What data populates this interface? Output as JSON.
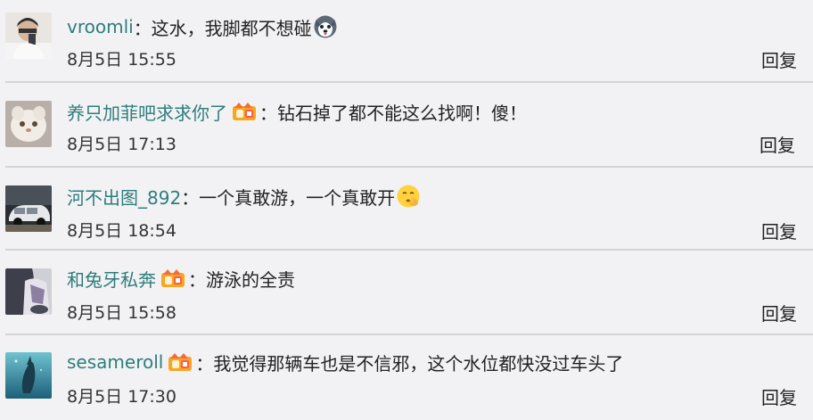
{
  "comments": [
    {
      "username": "vroomli",
      "has_badge": false,
      "text": "：这水，我脚都不想碰",
      "emoji": "husky-emoji",
      "time": "8月5日 15:55",
      "reply_label": "回复"
    },
    {
      "username": "养只加菲吧求求你了",
      "has_badge": true,
      "text": "：钻石掉了都不能这么找啊！傻！",
      "emoji": "",
      "time": "8月5日 17:13",
      "reply_label": "回复"
    },
    {
      "username": "河不出图_892",
      "has_badge": false,
      "text": "：一个真敢游，一个真敢开",
      "emoji": "shush-face-emoji",
      "time": "8月5日 18:54",
      "reply_label": "回复"
    },
    {
      "username": "和兔牙私奔",
      "has_badge": true,
      "text": "：游泳的全责",
      "emoji": "",
      "time": "8月5日 15:58",
      "reply_label": "回复"
    },
    {
      "username": "sesameroll",
      "has_badge": true,
      "text": "：我觉得那辆车也是不信邪，这个水位都快没过车头了",
      "emoji": "",
      "time": "8月5日 17:30",
      "reply_label": "回复"
    }
  ],
  "colors": {
    "background": "#f2f2f5",
    "username": "#2e7d7a",
    "divider": "#d3d3d8",
    "text": "#222222"
  }
}
